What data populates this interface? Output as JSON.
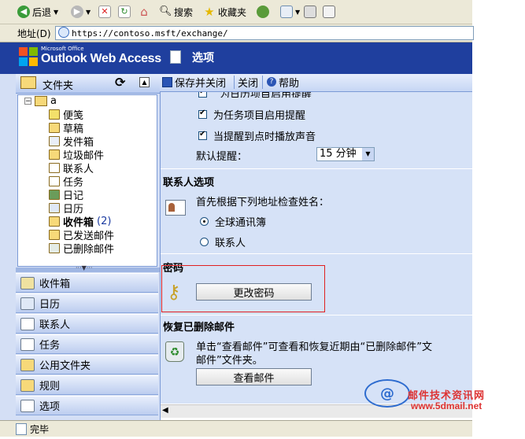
{
  "browser": {
    "toolbar": {
      "back_label": "后退",
      "search_label": "搜索",
      "favorites_label": "收藏夹"
    },
    "address": {
      "label": "地址(D)",
      "url": "https://contoso.msft/exchange/"
    },
    "status": "完毕"
  },
  "owa": {
    "brand_small": "Microsoft Office",
    "brand": "Outlook Web Access",
    "page_title": "选项"
  },
  "folders": {
    "title": "文件夹",
    "root": "a",
    "items": [
      {
        "label": "便笺",
        "icon": "note-icon"
      },
      {
        "label": "草稿",
        "icon": "drafts-icon"
      },
      {
        "label": "发件箱",
        "icon": "outbox-icon"
      },
      {
        "label": "垃圾邮件",
        "icon": "junk-mail-icon"
      },
      {
        "label": "联系人",
        "icon": "contacts-icon"
      },
      {
        "label": "任务",
        "icon": "tasks-icon"
      },
      {
        "label": "日记",
        "icon": "journal-icon"
      },
      {
        "label": "日历",
        "icon": "calendar-icon"
      },
      {
        "label": "收件箱",
        "count": "(2)",
        "icon": "inbox-icon"
      },
      {
        "label": "已发送邮件",
        "icon": "sent-items-icon"
      },
      {
        "label": "已删除邮件",
        "icon": "deleted-items-icon"
      }
    ]
  },
  "nav": [
    {
      "label": "收件箱",
      "icon": "inbox-icon"
    },
    {
      "label": "日历",
      "icon": "calendar-icon"
    },
    {
      "label": "联系人",
      "icon": "contacts-icon"
    },
    {
      "label": "任务",
      "icon": "tasks-icon"
    },
    {
      "label": "公用文件夹",
      "icon": "public-folders-icon"
    },
    {
      "label": "规则",
      "icon": "rules-icon"
    },
    {
      "label": "选项",
      "icon": "options-icon"
    }
  ],
  "toolbar": {
    "save_close": "保存并关闭",
    "close": "关闭",
    "help": "帮助"
  },
  "reminders": {
    "row_cut": "为日历项目启用提醒",
    "tasks_label": "为任务项目启用提醒",
    "sound_label": "当提醒到点时播放声音",
    "default_label": "默认提醒：",
    "default_value": "15 分钟"
  },
  "contacts_options": {
    "title": "联系人选项",
    "check_first": "首先根据下列地址检查姓名：",
    "gal_label": "全球通讯簿",
    "contacts_label": "联系人"
  },
  "password": {
    "title": "密码",
    "button": "更改密码"
  },
  "recover": {
    "title": "恢复已删除邮件",
    "line1": "单击“查看邮件”可查看和恢复近期由“已删除邮件”文",
    "line2": "邮件”文件夹。",
    "button": "查看邮件"
  },
  "watermark": {
    "line1": "邮件技术资讯网",
    "line2": "www.5dmail.net"
  },
  "colors": {
    "owa_blue": "#1f3f9e",
    "pane_blue": "#d6e2f7",
    "highlight_red": "#e02020"
  }
}
